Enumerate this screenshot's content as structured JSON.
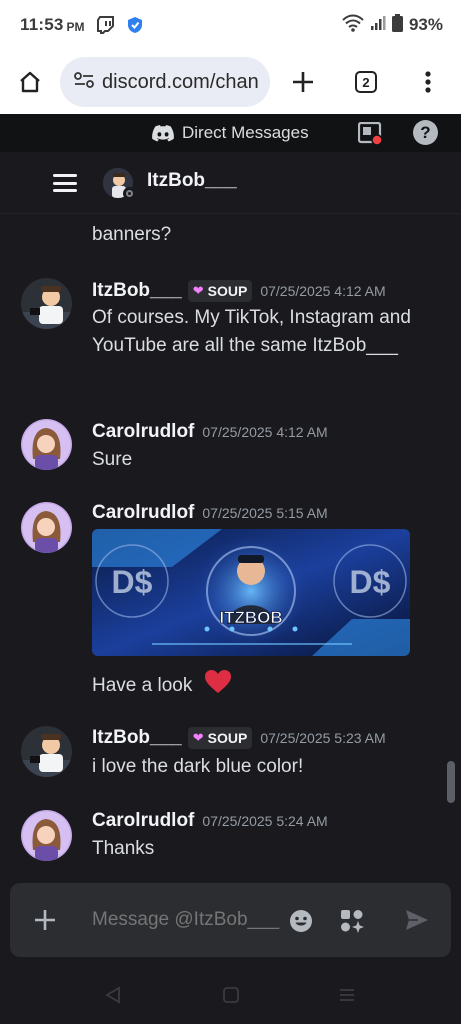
{
  "status_bar": {
    "time": "11:53",
    "ampm": "PM",
    "battery": "93%",
    "icons": [
      "twitch-icon",
      "shield-icon",
      "wifi-icon",
      "signal-icon",
      "battery-icon"
    ]
  },
  "browser": {
    "url": "discord.com/chan",
    "tab_count": "2",
    "icons": [
      "home-icon",
      "site-settings-icon",
      "new-tab-icon",
      "tabs-icon",
      "menu-icon"
    ]
  },
  "discord": {
    "top_bar": {
      "title": "Direct Messages"
    },
    "channel": {
      "name": "ItzBob___"
    },
    "messages": {
      "continued_text": "banners?",
      "items": [
        {
          "author": "ItzBob___",
          "tag": "SOUP",
          "time": "07/25/2025 4:12 AM",
          "text": "Of courses. My TikTok, Instagram and YouTube are all the same ItzBob___"
        },
        {
          "author": "Carolrudlof",
          "time": "07/25/2025 4:12 AM",
          "text": "Sure"
        },
        {
          "author": "Carolrudlof",
          "time": "07/25/2025 5:15 AM",
          "banner": {
            "title": "ITZBOB",
            "side_logo": "D$"
          },
          "text": "Have a look"
        },
        {
          "author": "ItzBob___",
          "tag": "SOUP",
          "time": "07/25/2025 5:23 AM",
          "text": "i love the dark blue color!"
        },
        {
          "author": "Carolrudlof",
          "time": "07/25/2025 5:24 AM",
          "text": "Thanks"
        }
      ]
    },
    "composer": {
      "placeholder": "Message @ItzBob___"
    }
  },
  "colors": {
    "background": "#1a1a1e",
    "top_bar": "#111214",
    "text": "#dbdee1",
    "timestamp": "#949ba4",
    "heart": "#dd2e44",
    "tag_heart": "#f47fff",
    "notification": "#f23f43"
  }
}
